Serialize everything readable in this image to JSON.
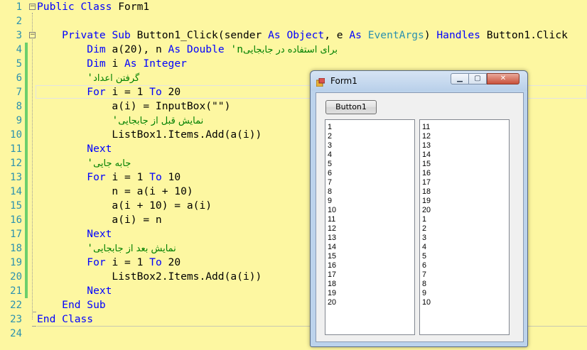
{
  "editor": {
    "lines": [
      {
        "n": "1",
        "fold": "−",
        "tokens": [
          {
            "t": "Public Class Form1",
            "c": "kw-mixed1"
          }
        ]
      },
      {
        "n": "2",
        "tokens": []
      },
      {
        "n": "3",
        "fold": "−",
        "tokens": []
      },
      {
        "n": "4",
        "tokens": []
      },
      {
        "n": "5",
        "tokens": []
      },
      {
        "n": "6",
        "tokens": []
      },
      {
        "n": "7",
        "tokens": []
      },
      {
        "n": "8",
        "tokens": []
      },
      {
        "n": "9",
        "tokens": []
      },
      {
        "n": "10",
        "tokens": []
      },
      {
        "n": "11",
        "tokens": []
      },
      {
        "n": "12",
        "tokens": []
      },
      {
        "n": "13",
        "tokens": []
      },
      {
        "n": "14",
        "tokens": []
      },
      {
        "n": "15",
        "tokens": []
      },
      {
        "n": "16",
        "tokens": []
      },
      {
        "n": "17",
        "tokens": []
      },
      {
        "n": "18",
        "tokens": []
      },
      {
        "n": "19",
        "tokens": []
      },
      {
        "n": "20",
        "tokens": []
      },
      {
        "n": "21",
        "tokens": []
      },
      {
        "n": "22",
        "tokens": []
      },
      {
        "n": "23",
        "tokens": []
      },
      {
        "n": "24",
        "tokens": []
      }
    ],
    "code": [
      [
        [
          "Public Class",
          "kw"
        ],
        [
          " Form1",
          ""
        ]
      ],
      [],
      [
        [
          "    ",
          ""
        ],
        [
          "Private Sub",
          "kw"
        ],
        [
          " Button1_Click(sender ",
          ""
        ],
        [
          "As",
          "kw"
        ],
        [
          " ",
          ""
        ],
        [
          "Object",
          "kw"
        ],
        [
          ", e ",
          ""
        ],
        [
          "As",
          "kw"
        ],
        [
          " ",
          ""
        ],
        [
          "EventArgs",
          "ty"
        ],
        [
          ") ",
          ""
        ],
        [
          "Handles",
          "kw"
        ],
        [
          " Button1.Click",
          ""
        ]
      ],
      [
        [
          "        ",
          ""
        ],
        [
          "Dim",
          "kw"
        ],
        [
          " a(20), n ",
          ""
        ],
        [
          "As",
          "kw"
        ],
        [
          " ",
          ""
        ],
        [
          "Double",
          "kw"
        ],
        [
          " ",
          ""
        ],
        [
          "'n",
          "cm"
        ],
        [
          " برای استفاده در جابجایی",
          "cm-fa"
        ]
      ],
      [
        [
          "        ",
          ""
        ],
        [
          "Dim",
          "kw"
        ],
        [
          " i ",
          ""
        ],
        [
          "As",
          "kw"
        ],
        [
          " ",
          ""
        ],
        [
          "Integer",
          "kw"
        ]
      ],
      [
        [
          "        ",
          ""
        ],
        [
          "'",
          "cm"
        ],
        [
          "گرفتن اعداد",
          "cm-fa"
        ]
      ],
      [
        [
          "        ",
          ""
        ],
        [
          "For",
          "kw"
        ],
        [
          " i = 1 ",
          ""
        ],
        [
          "To",
          "kw"
        ],
        [
          " 20",
          ""
        ]
      ],
      [
        [
          "            a(i) = InputBox(\"\")",
          ""
        ]
      ],
      [
        [
          "            ",
          ""
        ],
        [
          "'",
          "cm"
        ],
        [
          "نمایش قبل از جابجایی",
          "cm-fa"
        ]
      ],
      [
        [
          "            ListBox1.Items.Add(a(i))",
          ""
        ]
      ],
      [
        [
          "        ",
          ""
        ],
        [
          "Next",
          "kw"
        ]
      ],
      [
        [
          "        ",
          ""
        ],
        [
          "'",
          "cm"
        ],
        [
          "جابه جایی",
          "cm-fa"
        ]
      ],
      [
        [
          "        ",
          ""
        ],
        [
          "For",
          "kw"
        ],
        [
          " i = 1 ",
          ""
        ],
        [
          "To",
          "kw"
        ],
        [
          " 10",
          ""
        ]
      ],
      [
        [
          "            n = a(i + 10)",
          ""
        ]
      ],
      [
        [
          "            a(i + 10) = a(i)",
          ""
        ]
      ],
      [
        [
          "            a(i) = n",
          ""
        ]
      ],
      [
        [
          "        ",
          ""
        ],
        [
          "Next",
          "kw"
        ]
      ],
      [
        [
          "        ",
          ""
        ],
        [
          "'",
          "cm"
        ],
        [
          "نمایش بعد از جابجایی",
          "cm-fa"
        ]
      ],
      [
        [
          "        ",
          ""
        ],
        [
          "For",
          "kw"
        ],
        [
          " i = 1 ",
          ""
        ],
        [
          "To",
          "kw"
        ],
        [
          " 20",
          ""
        ]
      ],
      [
        [
          "            ListBox2.Items.Add(a(i))",
          ""
        ]
      ],
      [
        [
          "        ",
          ""
        ],
        [
          "Next",
          "kw"
        ]
      ],
      [
        [
          "    ",
          ""
        ],
        [
          "End Sub",
          "kw"
        ]
      ],
      [
        [
          "End Class",
          "kw"
        ]
      ],
      []
    ]
  },
  "form": {
    "title": "Form1",
    "button1_label": "Button1",
    "listbox1_items": [
      "1",
      "2",
      "3",
      "4",
      "5",
      "6",
      "7",
      "8",
      "9",
      "10",
      "11",
      "12",
      "13",
      "14",
      "15",
      "16",
      "17",
      "18",
      "19",
      "20"
    ],
    "listbox2_items": [
      "11",
      "12",
      "13",
      "14",
      "15",
      "16",
      "17",
      "18",
      "19",
      "20",
      "1",
      "2",
      "3",
      "4",
      "5",
      "6",
      "7",
      "8",
      "9",
      "10"
    ]
  },
  "colors": {
    "editor_background": "#fdf7a1",
    "keyword": "#0000ff",
    "type": "#2b91af",
    "comment": "#008000",
    "line_number": "#2b91af"
  }
}
